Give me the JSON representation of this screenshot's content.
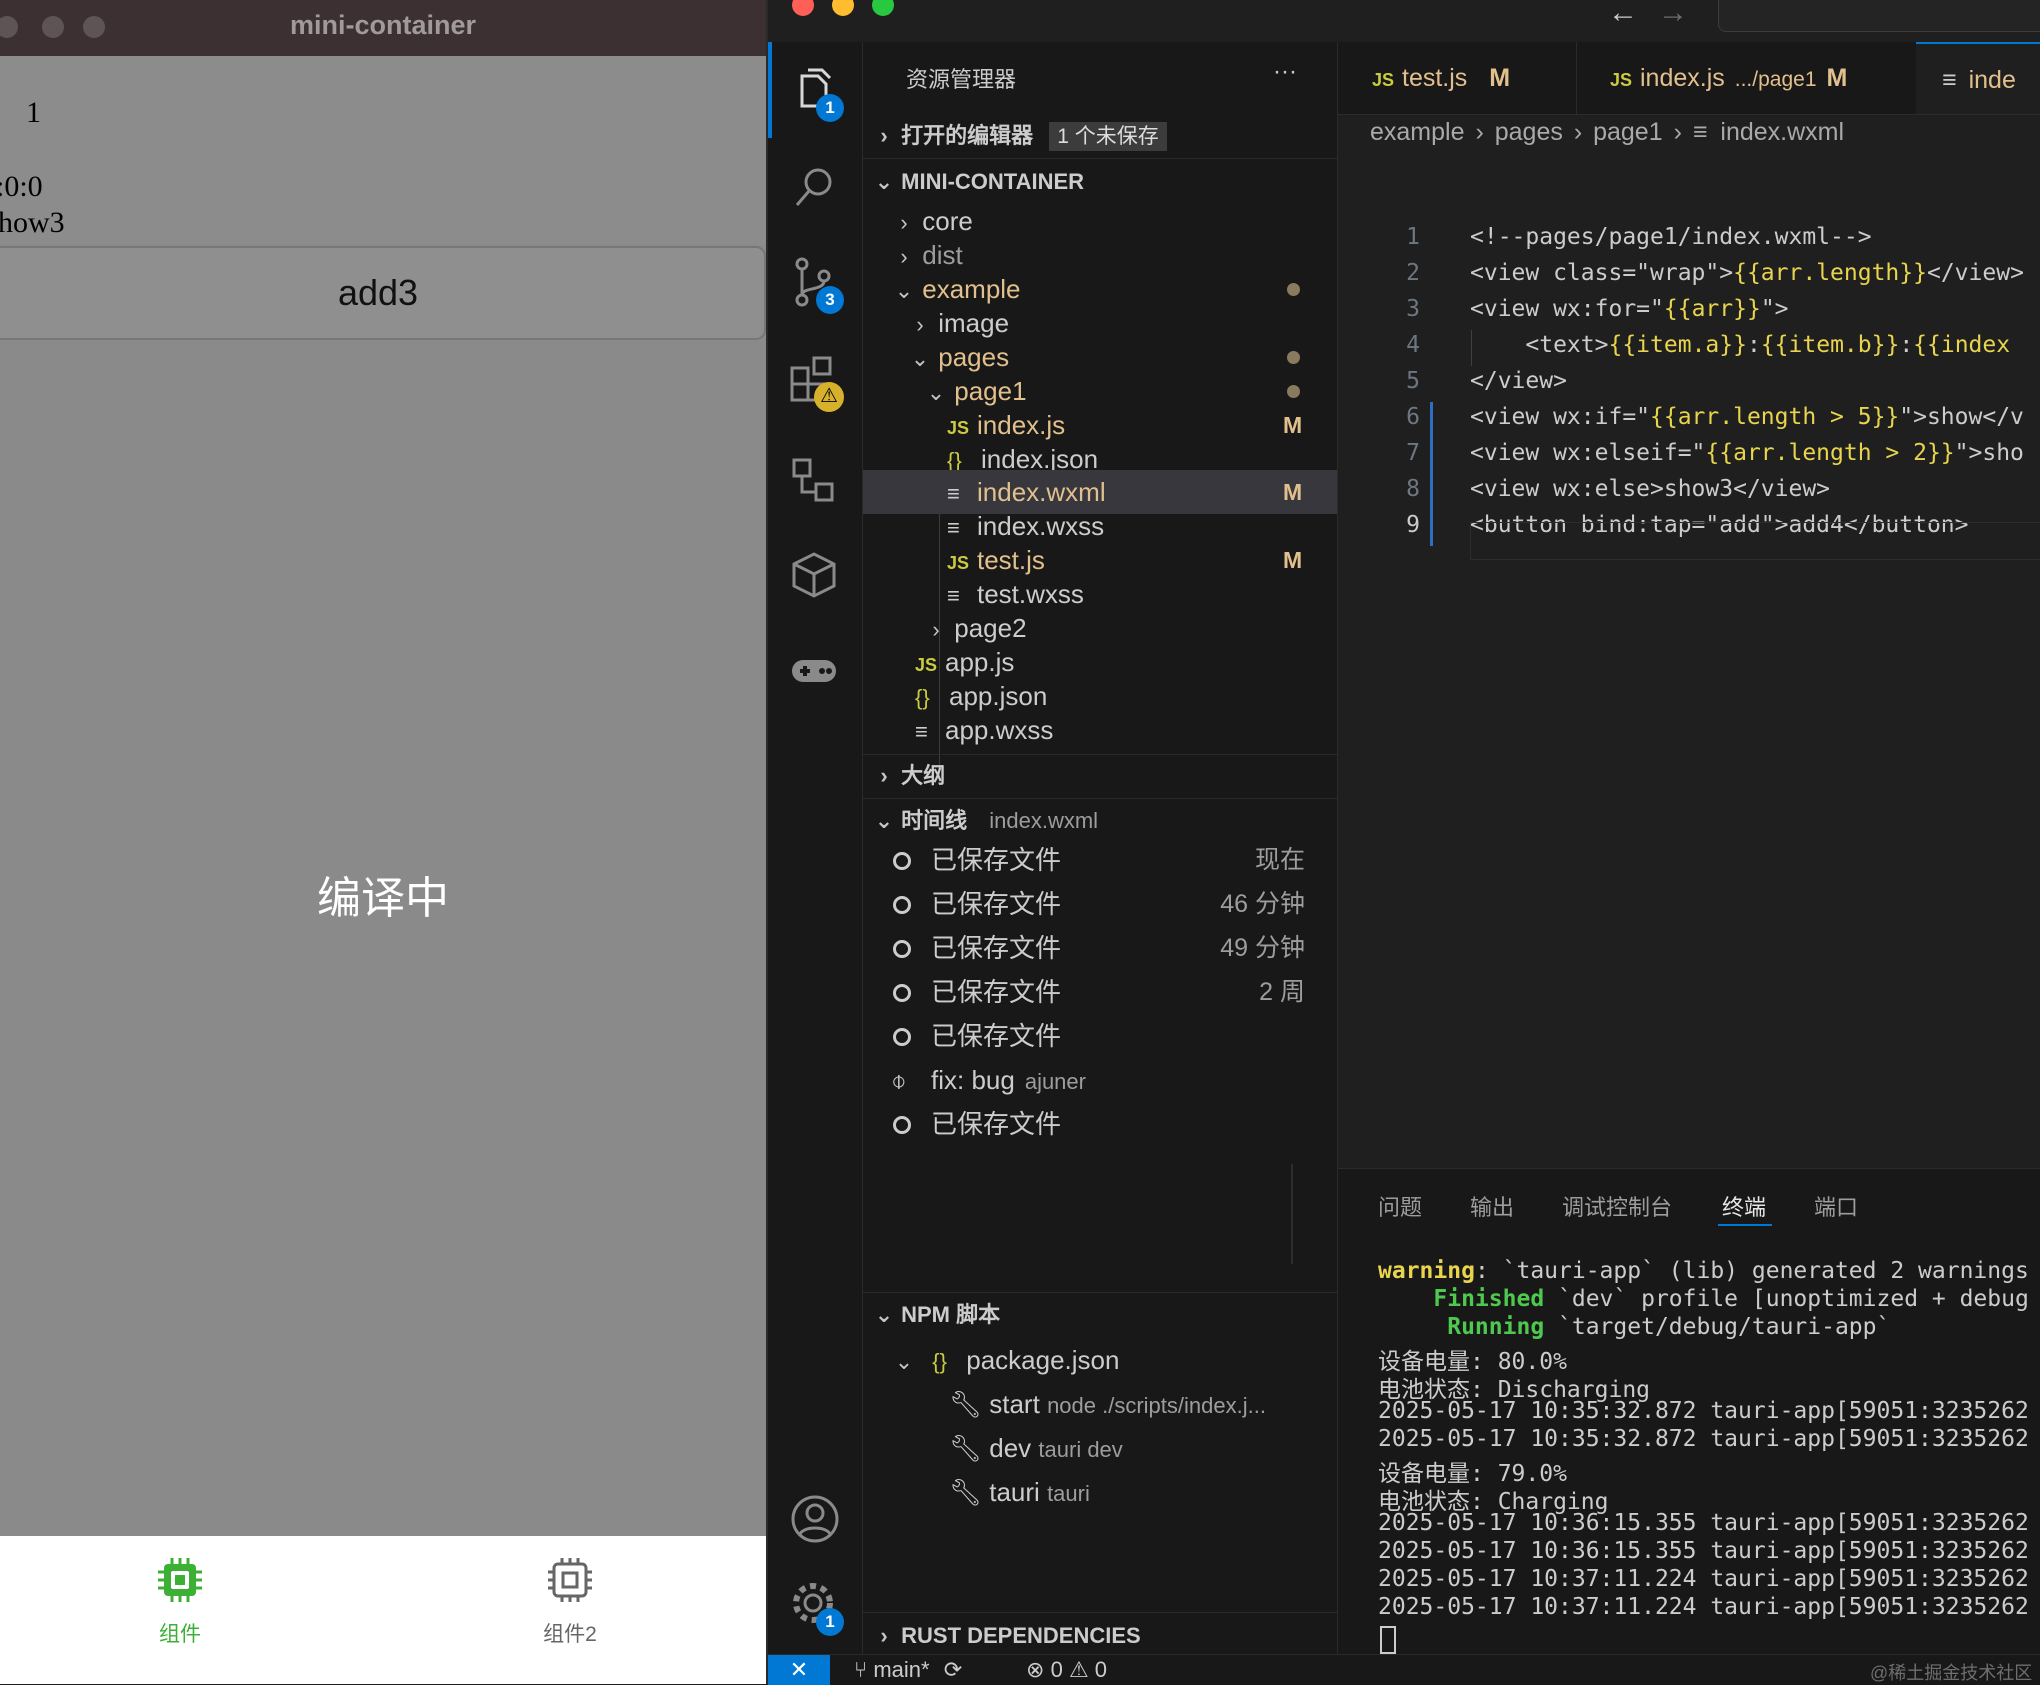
{
  "app": {
    "window_title": "mini-container",
    "line1": "1",
    "line2": ":0:0",
    "line3": "how3",
    "button_label": "add3",
    "loading_text": "编译中",
    "tabbar": [
      {
        "label": "组件",
        "active": true
      },
      {
        "label": "组件2",
        "active": false
      }
    ],
    "colors": {
      "active_tab": "#3cb034",
      "inactive_tab": "#666666"
    }
  },
  "activity_bar": {
    "explorer_badge": "1",
    "scm_badge": "3",
    "settings_badge": "1"
  },
  "sidebar": {
    "title": "资源管理器",
    "more": "···",
    "open_editors": "打开的编辑器",
    "unsaved_badge": "1 个未保存",
    "root": "MINI-CONTAINER",
    "tree": [
      {
        "label": "core"
      },
      {
        "label": "dist"
      },
      {
        "label": "example"
      },
      {
        "label": "image"
      },
      {
        "label": "pages"
      },
      {
        "label": "page1"
      },
      {
        "label": "index.js",
        "flag": "M"
      },
      {
        "label": "index.json"
      },
      {
        "label": "index.wxml",
        "flag": "M"
      },
      {
        "label": "index.wxss"
      },
      {
        "label": "test.js",
        "flag": "M"
      },
      {
        "label": "test.wxss"
      },
      {
        "label": "page2"
      },
      {
        "label": "app.js"
      },
      {
        "label": "app.json"
      },
      {
        "label": "app.wxss"
      }
    ],
    "outline": "大纲",
    "timeline": "时间线",
    "timeline_file": "index.wxml",
    "timeline_items": [
      {
        "label": "已保存文件",
        "time": "现在"
      },
      {
        "label": "已保存文件",
        "time": "46 分钟"
      },
      {
        "label": "已保存文件",
        "time": "49 分钟"
      },
      {
        "label": "已保存文件",
        "time": "2 周"
      },
      {
        "label": "已保存文件",
        "time": ""
      },
      {
        "label": "fix: bug",
        "author": "ajuner"
      },
      {
        "label": "已保存文件",
        "time": ""
      }
    ],
    "npm": "NPM 脚本",
    "package": "package.json",
    "scripts": [
      {
        "name": "start",
        "cmd": "node ./scripts/index.j..."
      },
      {
        "name": "dev",
        "cmd": "tauri dev"
      },
      {
        "name": "tauri",
        "cmd": "tauri"
      }
    ],
    "rust": "RUST DEPENDENCIES"
  },
  "editor": {
    "tabs": [
      {
        "icon": "JS",
        "name": "test.js",
        "path": "",
        "flag": "M"
      },
      {
        "icon": "JS",
        "name": "index.js",
        "path": ".../page1",
        "flag": "M"
      },
      {
        "icon": "≡",
        "name": "inde",
        "path": "",
        "flag": ""
      }
    ],
    "breadcrumbs": [
      "example",
      "pages",
      "page1",
      "index.wxml"
    ],
    "lines": [
      {
        "n": "1",
        "parts": [
          [
            "<!--pages/page1/index.wxml-->",
            ""
          ]
        ]
      },
      {
        "n": "2",
        "parts": [
          [
            "<view class=\"wrap\">",
            ""
          ],
          [
            "{{arr.length}}",
            "y"
          ],
          [
            "</view>",
            ""
          ]
        ]
      },
      {
        "n": "3",
        "parts": [
          [
            "<view wx:for=\"",
            ""
          ],
          [
            "{{arr}}",
            "y"
          ],
          [
            "\">",
            ""
          ]
        ]
      },
      {
        "n": "4",
        "parts": [
          [
            "    <text>",
            ""
          ],
          [
            "{{item.a}}",
            "y"
          ],
          [
            ":",
            ""
          ],
          [
            "{{item.b}}",
            "y"
          ],
          [
            ":",
            ""
          ],
          [
            "{{index",
            "y"
          ]
        ]
      },
      {
        "n": "5",
        "parts": [
          [
            "</view>",
            ""
          ]
        ]
      },
      {
        "n": "6",
        "parts": [
          [
            "<view wx:if=\"",
            ""
          ],
          [
            "{{arr.length > 5}}",
            "y"
          ],
          [
            "\">show</v",
            ""
          ]
        ]
      },
      {
        "n": "7",
        "parts": [
          [
            "<view wx:elseif=\"",
            ""
          ],
          [
            "{{arr.length > 2}}",
            "y"
          ],
          [
            "\">sho",
            ""
          ]
        ]
      },
      {
        "n": "8",
        "parts": [
          [
            "<view wx:else>show3</view>",
            ""
          ]
        ]
      },
      {
        "n": "9",
        "parts": [
          [
            "<button bind:tap=\"add\">add4</button>",
            ""
          ]
        ]
      }
    ]
  },
  "panel": {
    "tabs": [
      "问题",
      "输出",
      "调试控制台",
      "终端",
      "端口"
    ],
    "active_tab": "终端",
    "terminal": [
      {
        "a": "warning",
        "b": ": `tauri-app` (lib) generated 2 warnings",
        "ca": "#e8d44d"
      },
      {
        "a": "    Finished",
        "b": " `dev` profile [unoptimized + debug",
        "ca": "#4ec94e"
      },
      {
        "a": "     Running",
        "b": " `target/debug/tauri-app`",
        "ca": "#4ec94e"
      },
      {
        "a": "",
        "b": "设备电量: 80.0%",
        "ca": ""
      },
      {
        "a": "",
        "b": "电池状态: Discharging",
        "ca": ""
      },
      {
        "a": "",
        "b": "2025-05-17 10:35:32.872 tauri-app[59051:3235262",
        "ca": ""
      },
      {
        "a": "",
        "b": "2025-05-17 10:35:32.872 tauri-app[59051:3235262",
        "ca": ""
      },
      {
        "a": "",
        "b": "设备电量: 79.0%",
        "ca": ""
      },
      {
        "a": "",
        "b": "电池状态: Charging",
        "ca": ""
      },
      {
        "a": "",
        "b": "2025-05-17 10:36:15.355 tauri-app[59051:3235262",
        "ca": ""
      },
      {
        "a": "",
        "b": "2025-05-17 10:36:15.355 tauri-app[59051:3235262",
        "ca": ""
      },
      {
        "a": "",
        "b": "2025-05-17 10:37:11.224 tauri-app[59051:3235262",
        "ca": ""
      },
      {
        "a": "",
        "b": "2025-05-17 10:37:11.224 tauri-app[59051:3235262",
        "ca": ""
      }
    ]
  },
  "statusbar": {
    "branch": "main*",
    "errors": "0",
    "warnings": "0",
    "watermark": "@稀土掘金技术社区"
  }
}
